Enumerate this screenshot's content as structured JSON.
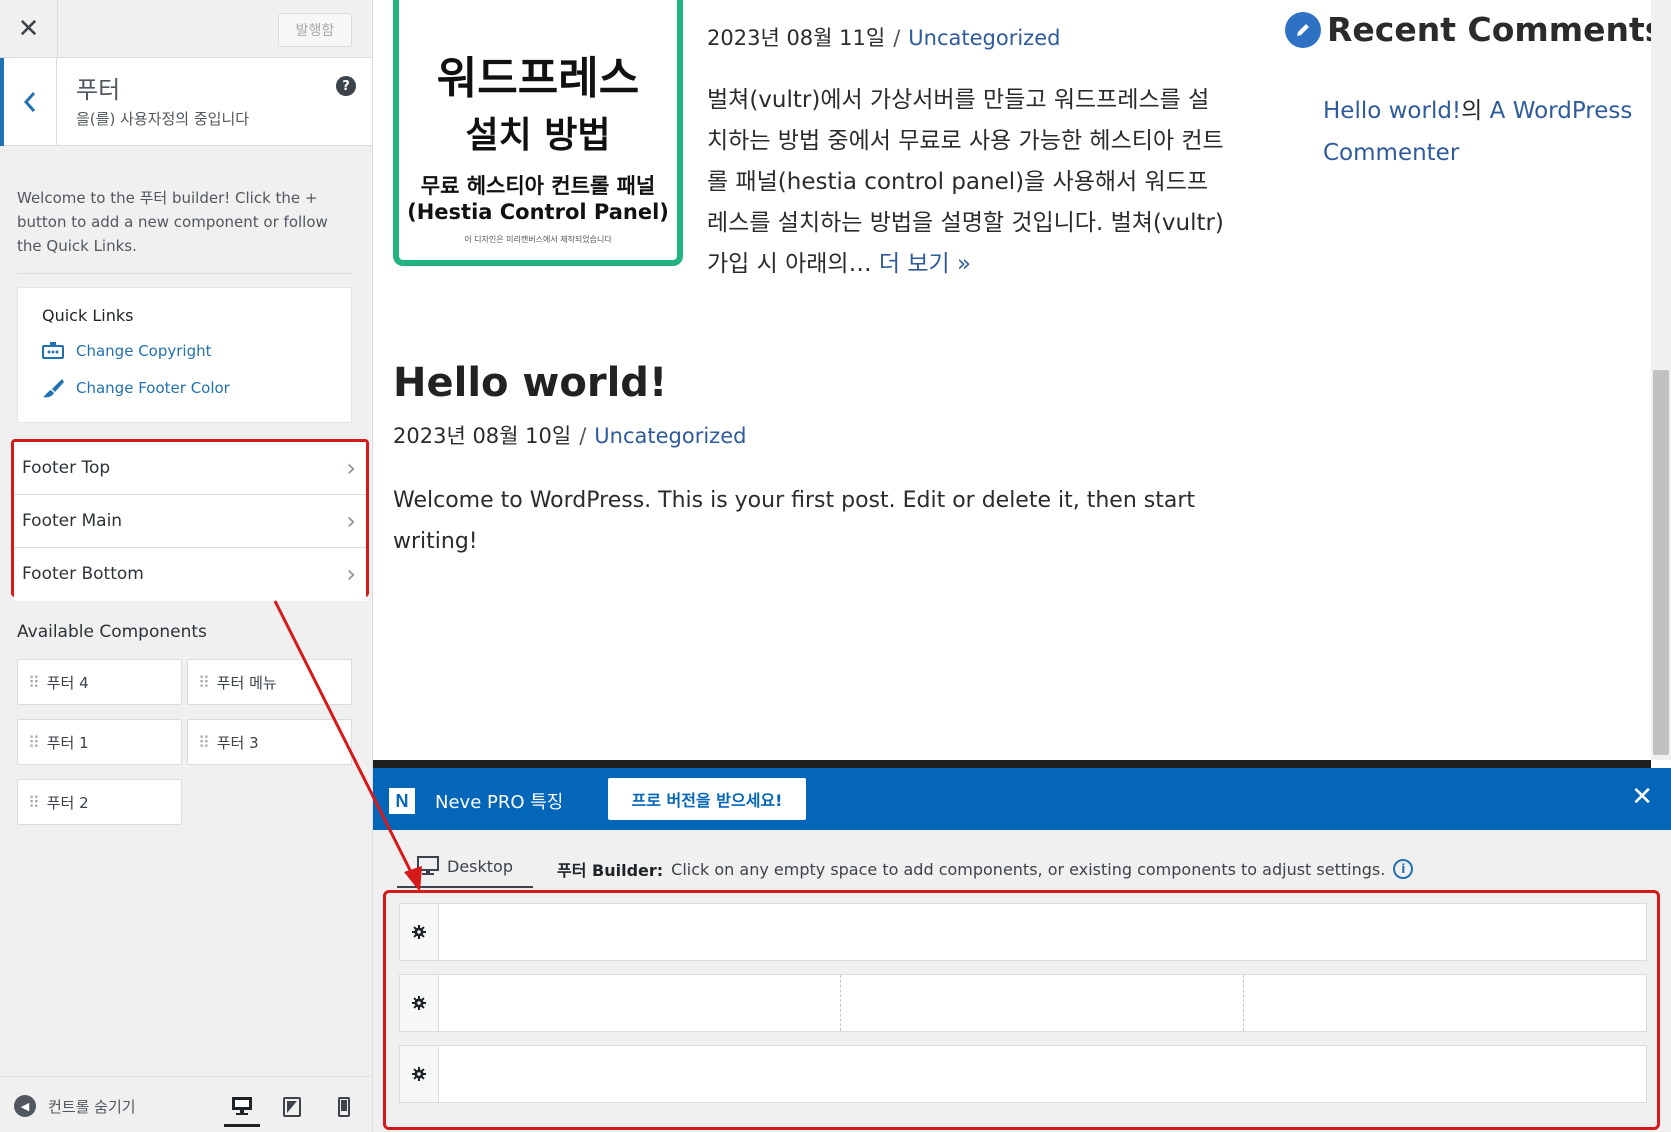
{
  "sidebar": {
    "close_label": "✕",
    "publish_label": "발행함",
    "back_label": "‹",
    "section_title": "푸터",
    "section_sub": "을(를) 사용자정의 중입니다",
    "help_label": "?",
    "welcome": "Welcome to the 푸터 builder! Click the + button to add a new component or follow the Quick Links.",
    "quick_links": {
      "title": "Quick Links",
      "items": [
        {
          "label": "Change Copyright",
          "icon": "copyright-icon"
        },
        {
          "label": "Change Footer Color",
          "icon": "brush-icon"
        }
      ]
    },
    "rows": [
      {
        "label": "Footer Top"
      },
      {
        "label": "Footer Main"
      },
      {
        "label": "Footer Bottom"
      }
    ],
    "available_title": "Available Components",
    "components": [
      "푸터 4",
      "푸터 메뉴",
      "푸터 1",
      "푸터 3",
      "푸터 2"
    ],
    "hide_controls": "컨트롤 숨기기"
  },
  "preview": {
    "thumb": {
      "line1": "워드프레스",
      "line2": "설치 방법",
      "line3": "무료 헤스티아 컨트롤 패널",
      "line4": "(Hestia Control Panel)",
      "line5": "이 디자인은 미리캔버스에서 제작되었습니다"
    },
    "post1": {
      "date": "2023년 08월 11일",
      "sep": "/",
      "category": "Uncategorized",
      "excerpt": "벌쳐(vultr)에서 가상서버를 만들고 워드프레스를 설치하는 방법 중에서 무료로 사용 가능한 헤스티아 컨트롤 패널(hestia control panel)을 사용해서 워드프레스를 설치하는 방법을 설명할 것입니다. 벌쳐(vultr) 가입 시 아래의…",
      "more": "더 보기 »"
    },
    "recent_comments": {
      "title": "Recent Comments",
      "post_link": "Hello world!",
      "of": "의",
      "author": "A WordPress Commenter"
    },
    "post2": {
      "title": "Hello world!",
      "date": "2023년 08월 10일",
      "sep": "/",
      "category": "Uncategorized",
      "body": "Welcome to WordPress. This is your first post. Edit or delete it, then start writing!"
    }
  },
  "neve": {
    "logo": "N",
    "title": "Neve PRO 특징",
    "cta": "프로 버전을 받으세요!",
    "close": "✕"
  },
  "builder": {
    "tab_label": "Desktop",
    "hint_bold": "푸터 Builder:",
    "hint_text": "Click on any empty space to add components, or existing components to adjust settings.",
    "info_label": "i"
  },
  "colors": {
    "accent": "#2271b1",
    "neve_blue": "#0366b8",
    "highlight_red": "#d61a1a",
    "thumb_green": "#20b27f"
  }
}
